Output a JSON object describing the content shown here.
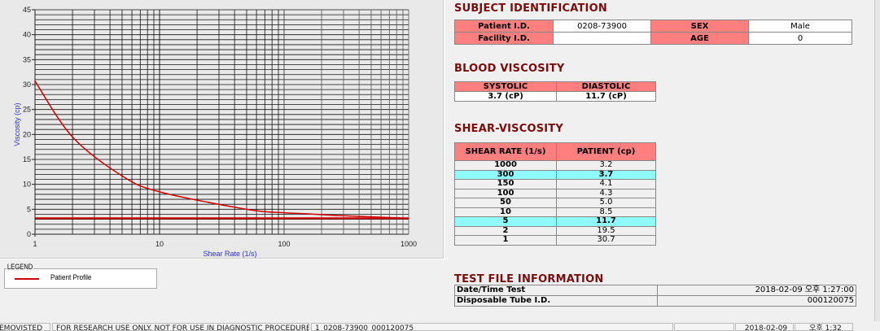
{
  "chart_data": {
    "type": "line",
    "xlabel": "Shear Rate (1/s)",
    "ylabel": "Viscosity (cp)",
    "xscale": "log",
    "xlim": [
      1,
      1000
    ],
    "ylim": [
      0,
      45
    ],
    "xticks": [
      "1",
      "10",
      "100",
      "1000"
    ],
    "yticks": [
      "0",
      "5",
      "10",
      "15",
      "20",
      "25",
      "30",
      "35",
      "40",
      "45"
    ],
    "grid": true,
    "series": [
      {
        "name": "Patient Profile",
        "color": "#d00000",
        "x": [
          1,
          2,
          5,
          10,
          50,
          100,
          150,
          300,
          1000
        ],
        "y": [
          30.7,
          19.5,
          11.7,
          8.5,
          5.0,
          4.3,
          4.1,
          3.7,
          3.2
        ]
      },
      {
        "color": "#d00000",
        "x": [
          1,
          1000
        ],
        "y": [
          3.2,
          3.2
        ]
      }
    ],
    "legend_placement": "below"
  },
  "legend": {
    "title": "LEGEND",
    "items": [
      {
        "label": "Patient Profile",
        "color": "#d00000"
      }
    ]
  },
  "subject": {
    "title": "SUBJECT IDENTIFICATION",
    "patient_id_label": "Patient I.D.",
    "patient_id": "0208-73900",
    "sex_label": "SEX",
    "sex": "Male",
    "facility_id_label": "Facility I.D.",
    "facility_id": "",
    "age_label": "AGE",
    "age": "0"
  },
  "blood": {
    "title": "BLOOD VISCOSITY",
    "systolic_label": "SYSTOLIC",
    "diastolic_label": "DIASTOLIC",
    "systolic": "3.7 (cP)",
    "diastolic": "11.7 (cP)"
  },
  "shear": {
    "title": "SHEAR-VISCOSITY",
    "headers": [
      "SHEAR RATE (1/s)",
      "PATIENT (cp)"
    ],
    "rows": [
      {
        "rate": "1000",
        "value": "3.2",
        "highlight": false
      },
      {
        "rate": "300",
        "value": "3.7",
        "highlight": true
      },
      {
        "rate": "150",
        "value": "4.1",
        "highlight": false
      },
      {
        "rate": "100",
        "value": "4.3",
        "highlight": false
      },
      {
        "rate": "50",
        "value": "5.0",
        "highlight": false
      },
      {
        "rate": "10",
        "value": "8.5",
        "highlight": false
      },
      {
        "rate": "5",
        "value": "11.7",
        "highlight": true
      },
      {
        "rate": "2",
        "value": "19.5",
        "highlight": false
      },
      {
        "rate": "1",
        "value": "30.7",
        "highlight": false
      }
    ],
    "highlight_color": "#8ffbfb"
  },
  "testfile": {
    "title": "TEST FILE INFORMATION",
    "datetime_label": "Date/Time Test",
    "datetime": "2018-02-09  오후 1:27:00",
    "tube_label": "Disposable Tube I.D.",
    "tube": "000120075"
  },
  "status": {
    "app": "EMOVISTED",
    "notice": "FOR RESEARCH USE ONLY. NOT FOR USE IN DIAGNOSTIC PROCEDURES",
    "file": "1_0208-73900_000120075",
    "blank": "",
    "date": "2018-02-09",
    "time": "오후 1:32"
  },
  "colors": {
    "header_red": "#ff7f7f",
    "section_title": "#7b0c0c",
    "curve": "#d00000",
    "axis_label": "#3030d0"
  }
}
